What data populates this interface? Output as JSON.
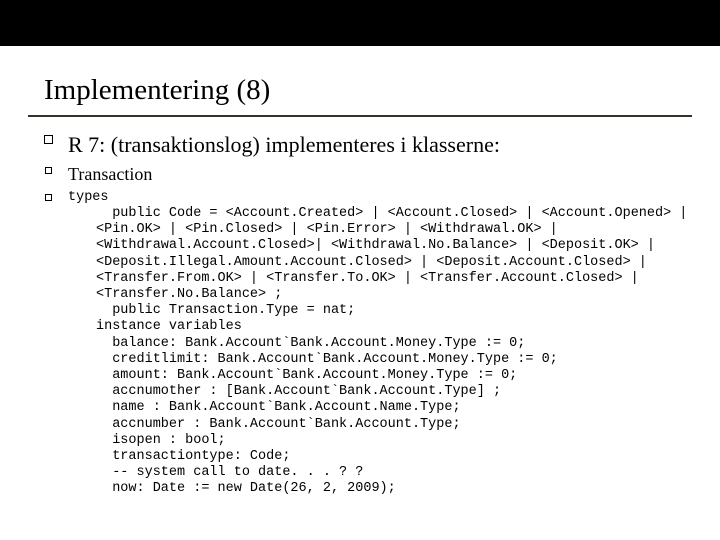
{
  "title": "Implementering (8)",
  "bullet1": "R 7: (transaktionslog) implementeres i klasserne:",
  "bullet2": "Transaction",
  "bullet3": "types",
  "code": "  public Code = <Account.Created> | <Account.Closed> | <Account.Opened> | <Pin.OK> | <Pin.Closed> | <Pin.Error> | <Withdrawal.OK> | <Withdrawal.Account.Closed>| <Withdrawal.No.Balance> | <Deposit.OK> | <Deposit.Illegal.Amount.Account.Closed> | <Deposit.Account.Closed> | <Transfer.From.OK> | <Transfer.To.OK> | <Transfer.Account.Closed> | <Transfer.No.Balance> ;\n  public Transaction.Type = nat;\ninstance variables\n  balance: Bank.Account`Bank.Account.Money.Type := 0;\n  creditlimit: Bank.Account`Bank.Account.Money.Type := 0;\n  amount: Bank.Account`Bank.Account.Money.Type := 0;\n  accnumother : [Bank.Account`Bank.Account.Type] ;\n  name : Bank.Account`Bank.Account.Name.Type;\n  accnumber : Bank.Account`Bank.Account.Type;\n  isopen : bool;\n  transactiontype: Code;\n  -- system call to date. . . ? ?\n  now: Date := new Date(26, 2, 2009);"
}
